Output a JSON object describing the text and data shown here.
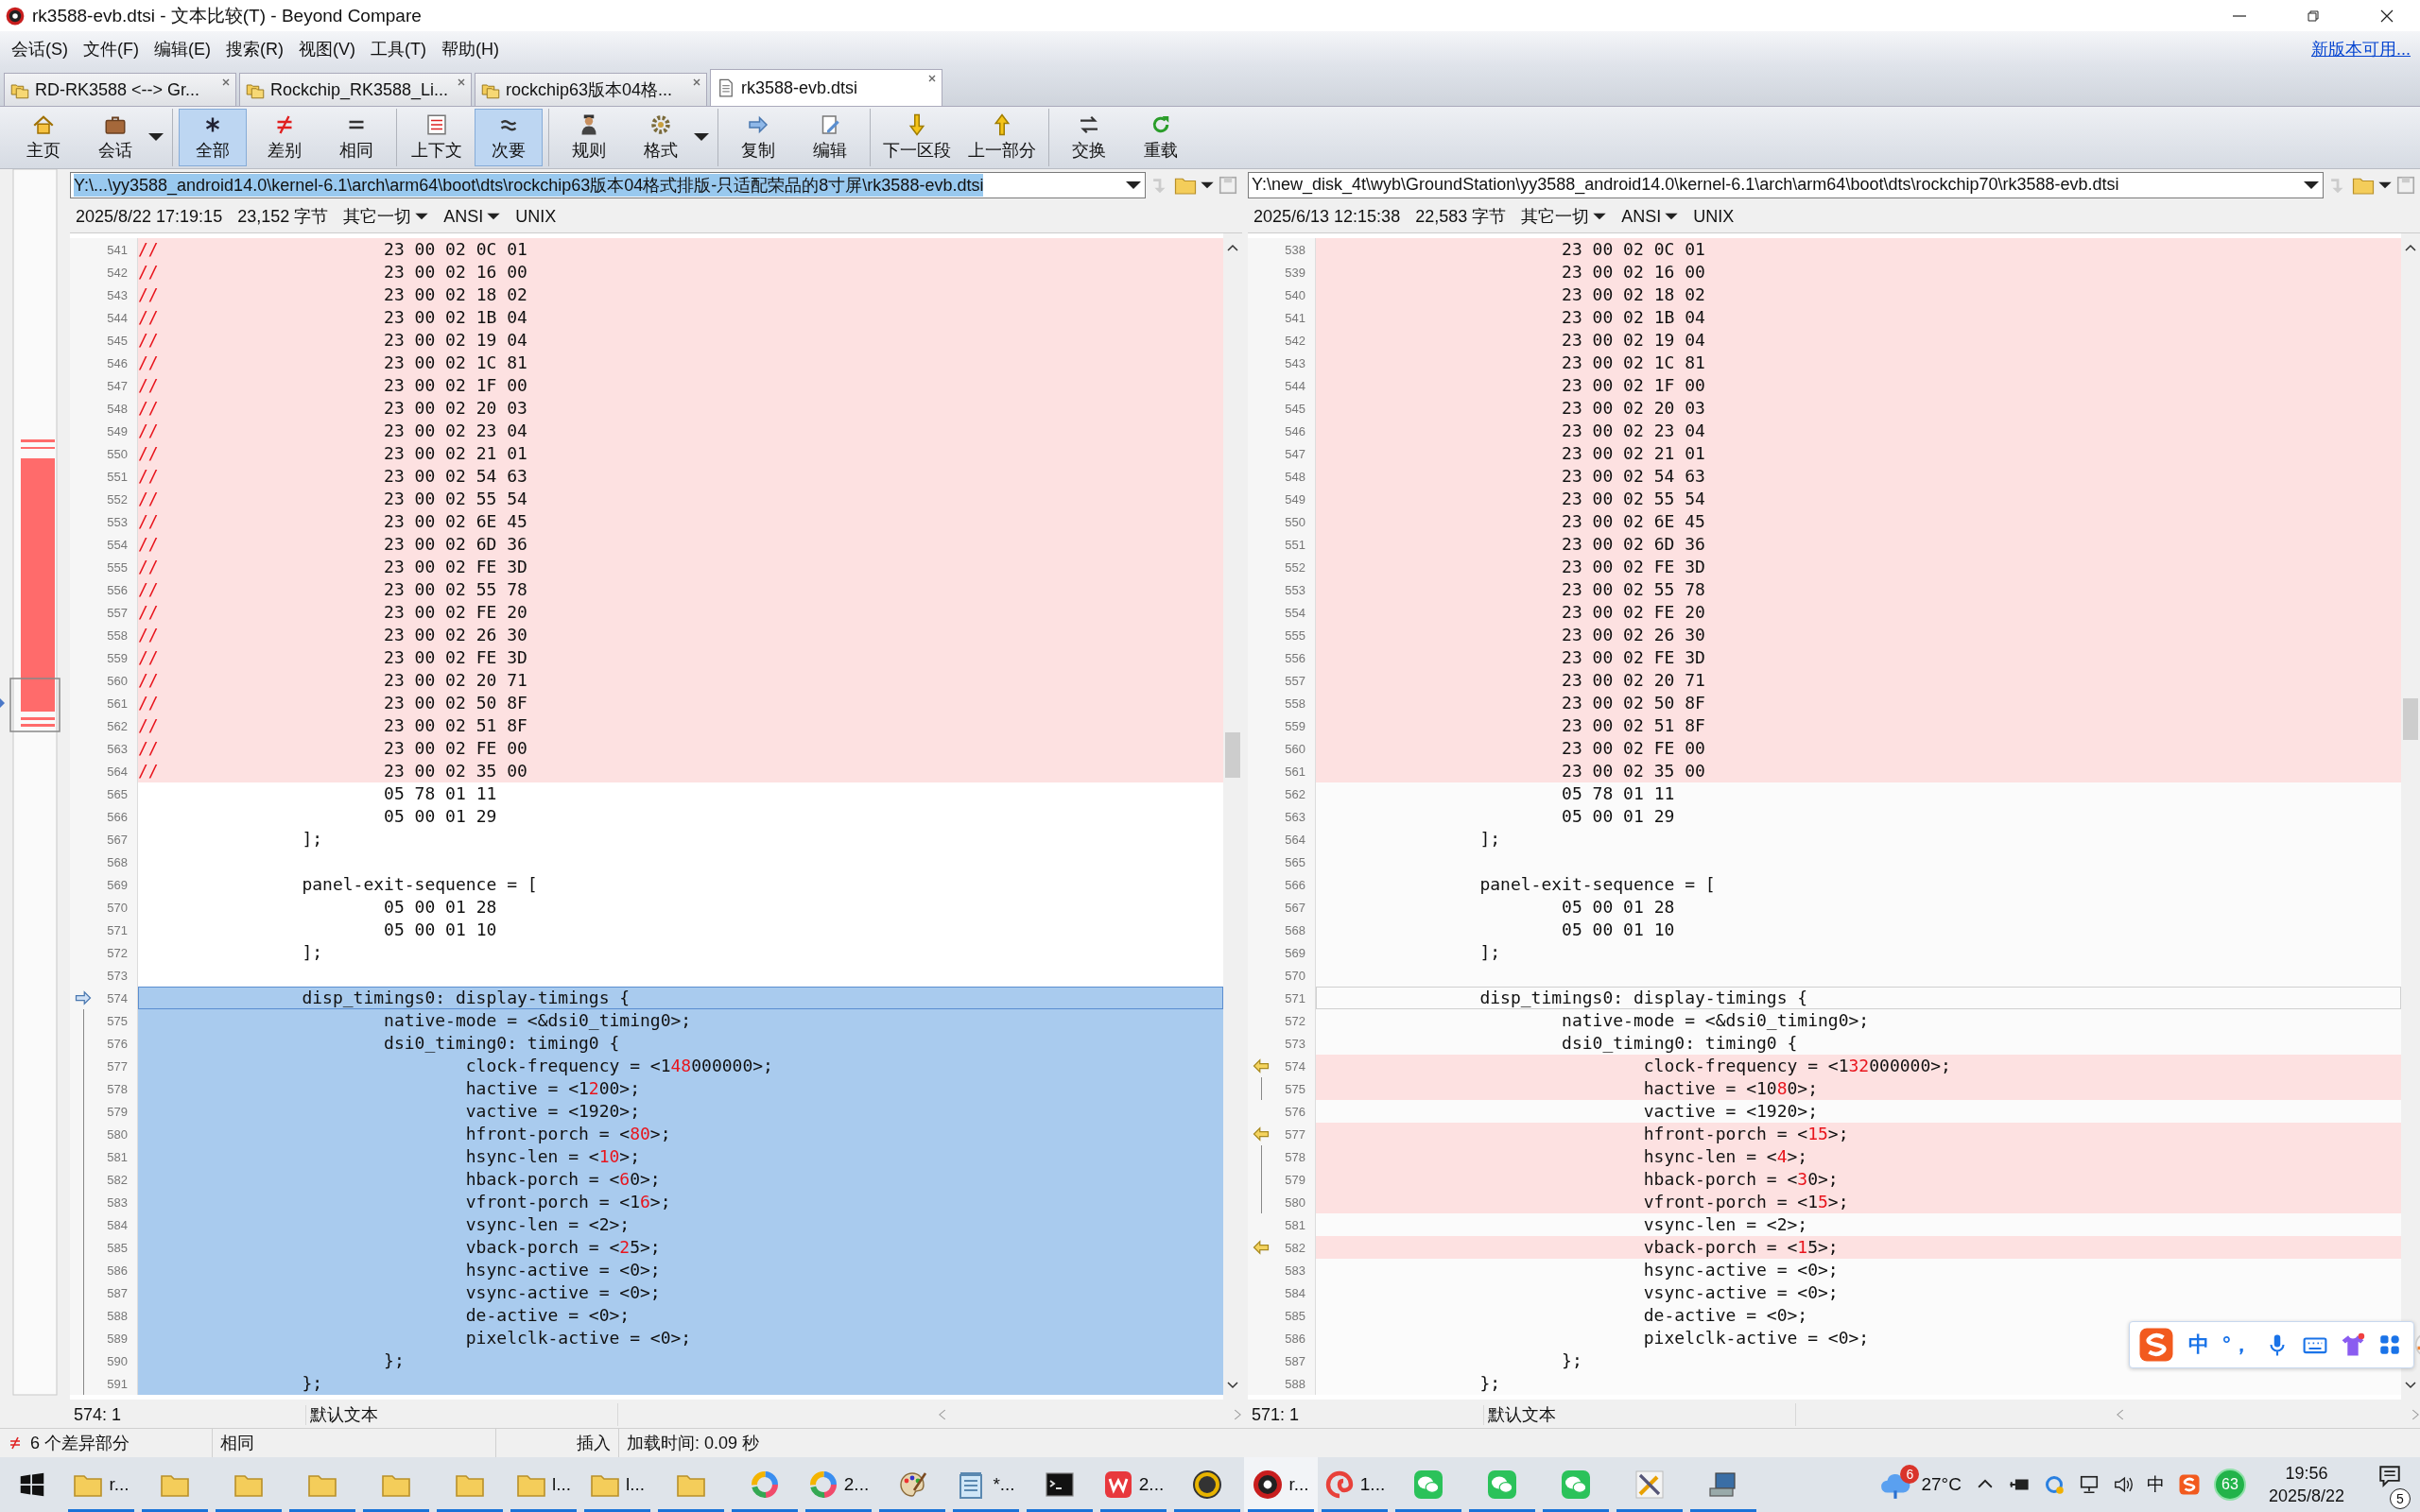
{
  "window": {
    "title": "rk3588-evb.dtsi - 文本比较(T) - Beyond Compare"
  },
  "menu": {
    "items": [
      "会话(S)",
      "文件(F)",
      "编辑(E)",
      "搜索(R)",
      "视图(V)",
      "工具(T)",
      "帮助(H)"
    ],
    "update_link": "新版本可用..."
  },
  "tabs": [
    {
      "label": "RD-RK3588 <--> Gr...",
      "kind": "folder",
      "selected": false
    },
    {
      "label": "Rockchip_RK3588_Li...",
      "kind": "folder",
      "selected": false
    },
    {
      "label": "rockchip63版本04格...",
      "kind": "folder",
      "selected": false
    },
    {
      "label": "rk3588-evb.dtsi",
      "kind": "file",
      "selected": true
    }
  ],
  "toolbar": {
    "groups": [
      [
        {
          "label": "主页",
          "kind": "home",
          "selected": false,
          "dropdown": false
        },
        {
          "label": "会话",
          "kind": "session",
          "selected": false,
          "dropdown": true
        }
      ],
      [
        {
          "label": "全部",
          "kind": "all",
          "selected": true,
          "dropdown": false
        },
        {
          "label": "差别",
          "kind": "diffs",
          "selected": false,
          "dropdown": false
        },
        {
          "label": "相同",
          "kind": "same",
          "selected": false,
          "dropdown": false
        }
      ],
      [
        {
          "label": "上下文",
          "kind": "context",
          "selected": false,
          "dropdown": false
        },
        {
          "label": "次要",
          "kind": "minor",
          "selected": true,
          "dropdown": false
        }
      ],
      [
        {
          "label": "规则",
          "kind": "rules",
          "selected": false,
          "dropdown": false
        },
        {
          "label": "格式",
          "kind": "format",
          "selected": false,
          "dropdown": true
        }
      ],
      [
        {
          "label": "复制",
          "kind": "copy",
          "selected": false,
          "dropdown": false
        },
        {
          "label": "编辑",
          "kind": "edit",
          "selected": false,
          "dropdown": false
        }
      ],
      [
        {
          "label": "下一区段",
          "kind": "next",
          "selected": false,
          "dropdown": false
        },
        {
          "label": "上一部分",
          "kind": "prev",
          "selected": false,
          "dropdown": false
        }
      ],
      [
        {
          "label": "交换",
          "kind": "swap",
          "selected": false,
          "dropdown": false
        },
        {
          "label": "重载",
          "kind": "reload",
          "selected": false,
          "dropdown": false
        }
      ]
    ]
  },
  "left_pane": {
    "path": "Y:\\...\\yy3588_android14.0\\kernel-6.1\\arch\\arm64\\boot\\dts\\rockchip63版本04格式排版-只适配荣品的8寸屏\\rk3588-evb.dtsi",
    "path_highlighted": true,
    "date": "2025/8/22 17:19:15",
    "size": "23,152 字节",
    "filter": "其它一切",
    "encoding": "ANSI",
    "line_endings": "UNIX",
    "cursor": "574: 1",
    "text_format": "默认文本",
    "lines": [
      {
        "n": "541",
        "kind": "differs",
        "parts": [
          {
            "text": "//",
            "changed": true
          },
          {
            "text": "\t\t\t23 00 02 0C 01",
            "changed": false
          }
        ]
      },
      {
        "n": "542",
        "kind": "differs",
        "parts": [
          {
            "text": "//",
            "changed": true
          },
          {
            "text": "\t\t\t23 00 02 16 00",
            "changed": false
          }
        ]
      },
      {
        "n": "543",
        "kind": "differs",
        "parts": [
          {
            "text": "//",
            "changed": true
          },
          {
            "text": "\t\t\t23 00 02 18 02",
            "changed": false
          }
        ]
      },
      {
        "n": "544",
        "kind": "differs",
        "parts": [
          {
            "text": "//",
            "changed": true
          },
          {
            "text": "\t\t\t23 00 02 1B 04",
            "changed": false
          }
        ]
      },
      {
        "n": "545",
        "kind": "differs",
        "parts": [
          {
            "text": "//",
            "changed": true
          },
          {
            "text": "\t\t\t23 00 02 19 04",
            "changed": false
          }
        ]
      },
      {
        "n": "546",
        "kind": "differs",
        "parts": [
          {
            "text": "//",
            "changed": true
          },
          {
            "text": "\t\t\t23 00 02 1C 81",
            "changed": false
          }
        ]
      },
      {
        "n": "547",
        "kind": "differs",
        "parts": [
          {
            "text": "//",
            "changed": true
          },
          {
            "text": "\t\t\t23 00 02 1F 00",
            "changed": false
          }
        ]
      },
      {
        "n": "548",
        "kind": "differs",
        "parts": [
          {
            "text": "//",
            "changed": true
          },
          {
            "text": "\t\t\t23 00 02 20 03",
            "changed": false
          }
        ]
      },
      {
        "n": "549",
        "kind": "differs",
        "parts": [
          {
            "text": "//",
            "changed": true
          },
          {
            "text": "\t\t\t23 00 02 23 04",
            "changed": false
          }
        ]
      },
      {
        "n": "550",
        "kind": "differs",
        "parts": [
          {
            "text": "//",
            "changed": true
          },
          {
            "text": "\t\t\t23 00 02 21 01",
            "changed": false
          }
        ]
      },
      {
        "n": "551",
        "kind": "differs",
        "parts": [
          {
            "text": "//",
            "changed": true
          },
          {
            "text": "\t\t\t23 00 02 54 63",
            "changed": false
          }
        ]
      },
      {
        "n": "552",
        "kind": "differs",
        "parts": [
          {
            "text": "//",
            "changed": true
          },
          {
            "text": "\t\t\t23 00 02 55 54",
            "changed": false
          }
        ]
      },
      {
        "n": "553",
        "kind": "differs",
        "parts": [
          {
            "text": "//",
            "changed": true
          },
          {
            "text": "\t\t\t23 00 02 6E 45",
            "changed": false
          }
        ]
      },
      {
        "n": "554",
        "kind": "differs",
        "parts": [
          {
            "text": "//",
            "changed": true
          },
          {
            "text": "\t\t\t23 00 02 6D 36",
            "changed": false
          }
        ]
      },
      {
        "n": "555",
        "kind": "differs",
        "parts": [
          {
            "text": "//",
            "changed": true
          },
          {
            "text": "\t\t\t23 00 02 FE 3D",
            "changed": false
          }
        ]
      },
      {
        "n": "556",
        "kind": "differs",
        "parts": [
          {
            "text": "//",
            "changed": true
          },
          {
            "text": "\t\t\t23 00 02 55 78",
            "changed": false
          }
        ]
      },
      {
        "n": "557",
        "kind": "differs",
        "parts": [
          {
            "text": "//",
            "changed": true
          },
          {
            "text": "\t\t\t23 00 02 FE 20",
            "changed": false
          }
        ]
      },
      {
        "n": "558",
        "kind": "differs",
        "parts": [
          {
            "text": "//",
            "changed": true
          },
          {
            "text": "\t\t\t23 00 02 26 30",
            "changed": false
          }
        ]
      },
      {
        "n": "559",
        "kind": "differs",
        "parts": [
          {
            "text": "//",
            "changed": true
          },
          {
            "text": "\t\t\t23 00 02 FE 3D",
            "changed": false
          }
        ]
      },
      {
        "n": "560",
        "kind": "differs",
        "parts": [
          {
            "text": "//",
            "changed": true
          },
          {
            "text": "\t\t\t23 00 02 20 71",
            "changed": false
          }
        ]
      },
      {
        "n": "561",
        "kind": "differs",
        "parts": [
          {
            "text": "//",
            "changed": true
          },
          {
            "text": "\t\t\t23 00 02 50 8F",
            "changed": false
          }
        ]
      },
      {
        "n": "562",
        "kind": "differs",
        "parts": [
          {
            "text": "//",
            "changed": true
          },
          {
            "text": "\t\t\t23 00 02 51 8F",
            "changed": false
          }
        ]
      },
      {
        "n": "563",
        "kind": "differs",
        "parts": [
          {
            "text": "//",
            "changed": true
          },
          {
            "text": "\t\t\t23 00 02 FE 00",
            "changed": false
          }
        ]
      },
      {
        "n": "564",
        "kind": "differs",
        "parts": [
          {
            "text": "//",
            "changed": true
          },
          {
            "text": "\t\t\t23 00 02 35 00",
            "changed": false
          }
        ]
      },
      {
        "n": "565",
        "kind": "same",
        "text": "\t\t\t05 78 01 11"
      },
      {
        "n": "566",
        "kind": "same",
        "text": "\t\t\t05 00 01 29"
      },
      {
        "n": "567",
        "kind": "same",
        "text": "\t\t];"
      },
      {
        "n": "568",
        "kind": "same"
      },
      {
        "n": "569",
        "kind": "same",
        "text": "\t\tpanel-exit-sequence = ["
      },
      {
        "n": "570",
        "kind": "same",
        "text": "\t\t\t05 00 01 28"
      },
      {
        "n": "571",
        "kind": "same",
        "text": "\t\t\t05 00 01 10"
      },
      {
        "n": "572",
        "kind": "same",
        "text": "\t\t];"
      },
      {
        "n": "573",
        "kind": "same"
      },
      {
        "n": "574",
        "kind": "selected",
        "current": true,
        "arrow": true,
        "text": "\t\tdisp_timings0: display-timings {"
      },
      {
        "n": "575",
        "kind": "selected",
        "bracket": true,
        "text": "\t\t\tnative-mode = <&dsi0_timing0>;"
      },
      {
        "n": "576",
        "kind": "selected",
        "bracket": true,
        "text": "\t\t\tdsi0_timing0: timing0 {"
      },
      {
        "n": "577",
        "kind": "selected",
        "bracket": true,
        "parts": [
          {
            "text": "\t\t\t\tclock-frequency = <1",
            "changed": false
          },
          {
            "text": "48",
            "changed": true
          },
          {
            "text": "000000>;",
            "changed": false
          }
        ]
      },
      {
        "n": "578",
        "kind": "selected",
        "bracket": true,
        "parts": [
          {
            "text": "\t\t\t\thactive = <1",
            "changed": false
          },
          {
            "text": "2",
            "changed": true
          },
          {
            "text": "00>;",
            "changed": false
          }
        ]
      },
      {
        "n": "579",
        "kind": "selected",
        "bracket": true,
        "text": "\t\t\t\tvactive = <1920>;"
      },
      {
        "n": "580",
        "kind": "selected",
        "bracket": true,
        "parts": [
          {
            "text": "\t\t\t\thfront-porch = <",
            "changed": false
          },
          {
            "text": "80",
            "changed": true
          },
          {
            "text": ">;",
            "changed": false
          }
        ]
      },
      {
        "n": "581",
        "kind": "selected",
        "bracket": true,
        "parts": [
          {
            "text": "\t\t\t\thsync-len = <",
            "changed": false
          },
          {
            "text": "10",
            "changed": true
          },
          {
            "text": ">;",
            "changed": false
          }
        ]
      },
      {
        "n": "582",
        "kind": "selected",
        "bracket": true,
        "parts": [
          {
            "text": "\t\t\t\thback-porch = <",
            "changed": false
          },
          {
            "text": "6",
            "changed": true
          },
          {
            "text": "0>;",
            "changed": false
          }
        ]
      },
      {
        "n": "583",
        "kind": "selected",
        "bracket": true,
        "parts": [
          {
            "text": "\t\t\t\tvfront-porch = <1",
            "changed": false
          },
          {
            "text": "6",
            "changed": true
          },
          {
            "text": ">;",
            "changed": false
          }
        ]
      },
      {
        "n": "584",
        "kind": "selected",
        "bracket": true,
        "text": "\t\t\t\tvsync-len = <2>;"
      },
      {
        "n": "585",
        "kind": "selected",
        "bracket": true,
        "parts": [
          {
            "text": "\t\t\t\tvback-porch = <",
            "changed": false
          },
          {
            "text": "2",
            "changed": true
          },
          {
            "text": "5>;",
            "changed": false
          }
        ]
      },
      {
        "n": "586",
        "kind": "selected",
        "bracket": true,
        "text": "\t\t\t\thsync-active = <0>;"
      },
      {
        "n": "587",
        "kind": "selected",
        "bracket": true,
        "text": "\t\t\t\tvsync-active = <0>;"
      },
      {
        "n": "588",
        "kind": "selected",
        "bracket": true,
        "text": "\t\t\t\tde-active = <0>;"
      },
      {
        "n": "589",
        "kind": "selected",
        "bracket": true,
        "text": "\t\t\t\tpixelclk-active = <0>;"
      },
      {
        "n": "590",
        "kind": "selected",
        "bracket": true,
        "text": "\t\t\t};"
      },
      {
        "n": "591",
        "kind": "selected",
        "bracket": true,
        "text": "\t\t};"
      }
    ]
  },
  "right_pane": {
    "path": "Y:\\new_disk_4t\\wyb\\GroundStation\\yy3588_android14.0\\kernel-6.1\\arch\\arm64\\boot\\dts\\rockchip70\\rk3588-evb.dtsi",
    "path_highlighted": false,
    "date": "2025/6/13 12:15:38",
    "size": "22,583 字节",
    "filter": "其它一切",
    "encoding": "ANSI",
    "line_endings": "UNIX",
    "cursor": "571: 1",
    "text_format": "默认文本",
    "lines": [
      {
        "n": "538",
        "kind": "differs",
        "text": "\t\t\t23 00 02 0C 01"
      },
      {
        "n": "539",
        "kind": "differs",
        "text": "\t\t\t23 00 02 16 00"
      },
      {
        "n": "540",
        "kind": "differs",
        "text": "\t\t\t23 00 02 18 02"
      },
      {
        "n": "541",
        "kind": "differs",
        "text": "\t\t\t23 00 02 1B 04"
      },
      {
        "n": "542",
        "kind": "differs",
        "text": "\t\t\t23 00 02 19 04"
      },
      {
        "n": "543",
        "kind": "differs",
        "text": "\t\t\t23 00 02 1C 81"
      },
      {
        "n": "544",
        "kind": "differs",
        "text": "\t\t\t23 00 02 1F 00"
      },
      {
        "n": "545",
        "kind": "differs",
        "text": "\t\t\t23 00 02 20 03"
      },
      {
        "n": "546",
        "kind": "differs",
        "text": "\t\t\t23 00 02 23 04"
      },
      {
        "n": "547",
        "kind": "differs",
        "text": "\t\t\t23 00 02 21 01"
      },
      {
        "n": "548",
        "kind": "differs",
        "text": "\t\t\t23 00 02 54 63"
      },
      {
        "n": "549",
        "kind": "differs",
        "text": "\t\t\t23 00 02 55 54"
      },
      {
        "n": "550",
        "kind": "differs",
        "text": "\t\t\t23 00 02 6E 45"
      },
      {
        "n": "551",
        "kind": "differs",
        "text": "\t\t\t23 00 02 6D 36"
      },
      {
        "n": "552",
        "kind": "differs",
        "text": "\t\t\t23 00 02 FE 3D"
      },
      {
        "n": "553",
        "kind": "differs",
        "text": "\t\t\t23 00 02 55 78"
      },
      {
        "n": "554",
        "kind": "differs",
        "text": "\t\t\t23 00 02 FE 20"
      },
      {
        "n": "555",
        "kind": "differs",
        "text": "\t\t\t23 00 02 26 30"
      },
      {
        "n": "556",
        "kind": "differs",
        "text": "\t\t\t23 00 02 FE 3D"
      },
      {
        "n": "557",
        "kind": "differs",
        "text": "\t\t\t23 00 02 20 71"
      },
      {
        "n": "558",
        "kind": "differs",
        "text": "\t\t\t23 00 02 50 8F"
      },
      {
        "n": "559",
        "kind": "differs",
        "text": "\t\t\t23 00 02 51 8F"
      },
      {
        "n": "560",
        "kind": "differs",
        "text": "\t\t\t23 00 02 FE 00"
      },
      {
        "n": "561",
        "kind": "differs",
        "text": "\t\t\t23 00 02 35 00"
      },
      {
        "n": "562",
        "kind": "same",
        "text": "\t\t\t05 78 01 11"
      },
      {
        "n": "563",
        "kind": "same",
        "text": "\t\t\t05 00 01 29"
      },
      {
        "n": "564",
        "kind": "same",
        "text": "\t\t];"
      },
      {
        "n": "565",
        "kind": "same"
      },
      {
        "n": "566",
        "kind": "same",
        "text": "\t\tpanel-exit-sequence = ["
      },
      {
        "n": "567",
        "kind": "same",
        "text": "\t\t\t05 00 01 28"
      },
      {
        "n": "568",
        "kind": "same",
        "text": "\t\t\t05 00 01 10"
      },
      {
        "n": "569",
        "kind": "same",
        "text": "\t\t];"
      },
      {
        "n": "570",
        "kind": "same"
      },
      {
        "n": "571",
        "kind": "same",
        "current": true,
        "text": "\t\tdisp_timings0: display-timings {"
      },
      {
        "n": "572",
        "kind": "same",
        "text": "\t\t\tnative-mode = <&dsi0_timing0>;"
      },
      {
        "n": "573",
        "kind": "same",
        "text": "\t\t\tdsi0_timing0: timing0 {"
      },
      {
        "n": "574",
        "kind": "differs",
        "arrow": true,
        "parts": [
          {
            "text": "\t\t\t\tclock-frequency = <1",
            "changed": false
          },
          {
            "text": "32",
            "changed": true
          },
          {
            "text": "000000>;",
            "changed": false
          }
        ]
      },
      {
        "n": "575",
        "kind": "differs",
        "bracket": true,
        "parts": [
          {
            "text": "\t\t\t\thactive = <10",
            "changed": false
          },
          {
            "text": "8",
            "changed": true
          },
          {
            "text": "0>;",
            "changed": false
          }
        ]
      },
      {
        "n": "576",
        "kind": "same",
        "text": "\t\t\t\tvactive = <1920>;"
      },
      {
        "n": "577",
        "kind": "differs",
        "arrow": true,
        "parts": [
          {
            "text": "\t\t\t\thfront-porch = <",
            "changed": false
          },
          {
            "text": "15",
            "changed": true
          },
          {
            "text": ">;",
            "changed": false
          }
        ]
      },
      {
        "n": "578",
        "kind": "differs",
        "bracket": true,
        "parts": [
          {
            "text": "\t\t\t\thsync-len = <",
            "changed": false
          },
          {
            "text": "4",
            "changed": true
          },
          {
            "text": ">;",
            "changed": false
          }
        ]
      },
      {
        "n": "579",
        "kind": "differs",
        "bracket": true,
        "parts": [
          {
            "text": "\t\t\t\thback-porch = <",
            "changed": false
          },
          {
            "text": "3",
            "changed": true
          },
          {
            "text": "0>;",
            "changed": false
          }
        ]
      },
      {
        "n": "580",
        "kind": "differs",
        "bracket": true,
        "parts": [
          {
            "text": "\t\t\t\tvfront-porch = <1",
            "changed": false
          },
          {
            "text": "5",
            "changed": true
          },
          {
            "text": ">;",
            "changed": false
          }
        ]
      },
      {
        "n": "581",
        "kind": "same",
        "text": "\t\t\t\tvsync-len = <2>;"
      },
      {
        "n": "582",
        "kind": "differs",
        "arrow": true,
        "parts": [
          {
            "text": "\t\t\t\tvback-porch = <",
            "changed": false
          },
          {
            "text": "1",
            "changed": true
          },
          {
            "text": "5>;",
            "changed": false
          }
        ]
      },
      {
        "n": "583",
        "kind": "same",
        "text": "\t\t\t\thsync-active = <0>;"
      },
      {
        "n": "584",
        "kind": "same",
        "text": "\t\t\t\tvsync-active = <0>;"
      },
      {
        "n": "585",
        "kind": "same",
        "text": "\t\t\t\tde-active = <0>;"
      },
      {
        "n": "586",
        "kind": "same",
        "text": "\t\t\t\tpixelclk-active = <0>;"
      },
      {
        "n": "587",
        "kind": "same",
        "text": "\t\t\t};"
      },
      {
        "n": "588",
        "kind": "same",
        "text": "\t\t};"
      }
    ]
  },
  "status_bar": {
    "diff_count": "6 个差异部分",
    "compare_mode": "相同",
    "edit_mode": "插入",
    "load_time": "加载时间: 0.09 秒"
  },
  "ime_bar": {
    "labels": [
      "中",
      "°，"
    ]
  },
  "taskbar": {
    "items": [
      {
        "kind": "folder",
        "label": "r...",
        "running": true,
        "active": false
      },
      {
        "kind": "folder",
        "running": true,
        "active": false
      },
      {
        "kind": "folder",
        "running": true,
        "active": false
      },
      {
        "kind": "folder",
        "running": true,
        "active": false
      },
      {
        "kind": "folder",
        "running": true,
        "active": false
      },
      {
        "kind": "folder",
        "running": true,
        "active": false
      },
      {
        "kind": "folder",
        "label": "l...",
        "running": true,
        "active": false
      },
      {
        "kind": "folder",
        "label": "l...",
        "running": true,
        "active": false
      },
      {
        "kind": "folder",
        "running": true,
        "active": false
      },
      {
        "kind": "ring",
        "running": true,
        "active": false
      },
      {
        "kind": "ring",
        "label": "2...",
        "running": true,
        "active": false
      },
      {
        "kind": "palette",
        "running": true,
        "active": false
      },
      {
        "kind": "notepad",
        "label": "*...",
        "running": true,
        "active": false
      },
      {
        "kind": "terminal",
        "running": true,
        "active": false
      },
      {
        "kind": "wps",
        "label": "2...",
        "running": true,
        "active": false
      },
      {
        "kind": "ue",
        "running": true,
        "active": false
      },
      {
        "kind": "disc",
        "label": "r...",
        "running": true,
        "active": true
      },
      {
        "kind": "swirl",
        "label": "1...",
        "running": true,
        "active": false
      },
      {
        "kind": "chat",
        "running": true,
        "active": false
      },
      {
        "kind": "chat",
        "running": true,
        "active": false
      },
      {
        "kind": "chat",
        "running": true,
        "active": false
      },
      {
        "kind": "tools",
        "running": true,
        "active": false
      },
      {
        "kind": "computer",
        "running": true,
        "active": false
      }
    ],
    "weather": {
      "badge": "6",
      "temperature": "27°C"
    },
    "input_method": "中",
    "security_score": "63",
    "time": "19:56",
    "date": "2025/8/22",
    "notification_count": "5"
  }
}
